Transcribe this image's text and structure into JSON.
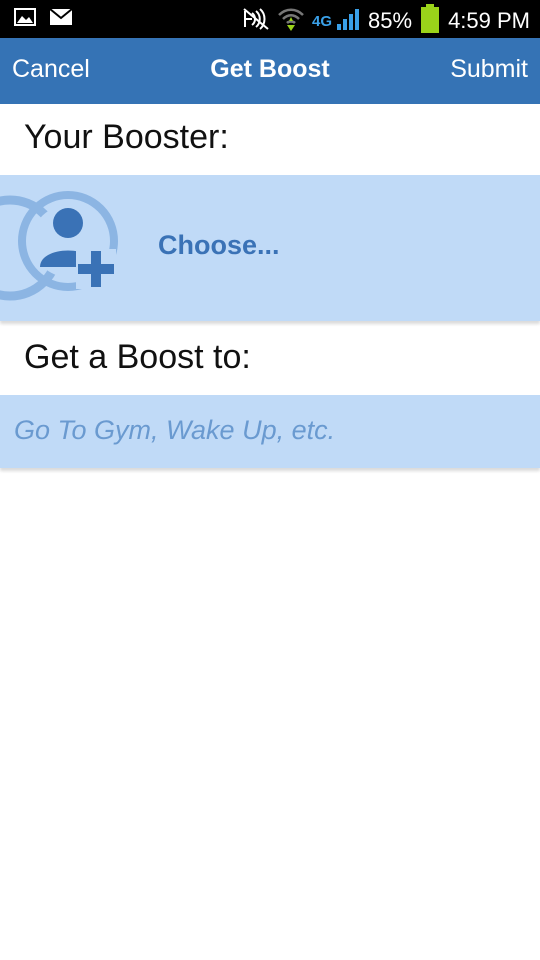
{
  "status_bar": {
    "network_type": "4G",
    "battery_percent": "85%",
    "time": "4:59 PM",
    "left_icons": [
      "image-icon",
      "email-icon"
    ],
    "right_icons": [
      "nfc-muted-icon",
      "wifi-icon",
      "signal-icon",
      "battery-icon"
    ],
    "battery_level": 0.85,
    "battery_color": "#9ad31a"
  },
  "app_bar": {
    "cancel_label": "Cancel",
    "title": "Get Boost",
    "submit_label": "Submit",
    "background": "#3573b5"
  },
  "booster_section": {
    "label": "Your Booster:",
    "choose_label": "Choose...",
    "icon": "add-person-icon"
  },
  "goal_section": {
    "label": "Get a Boost to:",
    "placeholder": "Go To Gym, Wake Up, etc."
  },
  "colors": {
    "row_background": "#c0daf7",
    "accent_text": "#3a72b6"
  }
}
